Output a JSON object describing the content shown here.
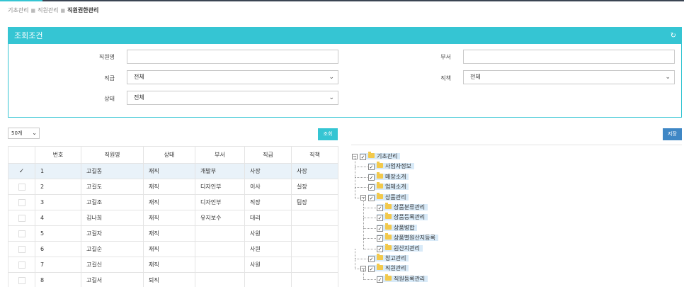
{
  "breadcrumb": {
    "items": [
      "기초관리",
      "직원관리"
    ],
    "current": "직원권한관리"
  },
  "panel": {
    "title": "조회조건",
    "fields": {
      "name_label": "직원명",
      "name_value": "",
      "dept_label": "부서",
      "dept_value": "",
      "grade_label": "직급",
      "grade_value": "전체",
      "position_label": "직책",
      "position_value": "전체",
      "status_label": "상태",
      "status_value": "전체"
    }
  },
  "toolbar": {
    "page_size": "50개",
    "search_label": "조회",
    "save_label": "저장"
  },
  "table": {
    "headers": [
      "",
      "번호",
      "직원명",
      "상태",
      "부서",
      "직급",
      "직책"
    ],
    "rows": [
      {
        "checked": "✓",
        "no": "1",
        "name": "고길동",
        "status": "재직",
        "dept": "개발부",
        "grade": "사장",
        "position": "사장"
      },
      {
        "checked": "",
        "no": "2",
        "name": "고길도",
        "status": "재직",
        "dept": "디자인부",
        "grade": "이사",
        "position": "실장"
      },
      {
        "checked": "",
        "no": "3",
        "name": "고길조",
        "status": "재직",
        "dept": "디자인부",
        "grade": "직장",
        "position": "팀장"
      },
      {
        "checked": "",
        "no": "4",
        "name": "김나희",
        "status": "재직",
        "dept": "유지보수",
        "grade": "대리",
        "position": ""
      },
      {
        "checked": "",
        "no": "5",
        "name": "고길자",
        "status": "재직",
        "dept": "",
        "grade": "사원",
        "position": ""
      },
      {
        "checked": "",
        "no": "6",
        "name": "고길순",
        "status": "재직",
        "dept": "",
        "grade": "사원",
        "position": ""
      },
      {
        "checked": "",
        "no": "7",
        "name": "고길신",
        "status": "재직",
        "dept": "",
        "grade": "사원",
        "position": ""
      },
      {
        "checked": "",
        "no": "8",
        "name": "고길서",
        "status": "퇴직",
        "dept": "",
        "grade": "",
        "position": ""
      }
    ]
  },
  "tree": {
    "nodes": [
      {
        "label": "기초관리",
        "level": 0,
        "toggle": "−",
        "check": "✓"
      },
      {
        "label": "사업자정보",
        "level": 1,
        "toggle": "",
        "check": "✓"
      },
      {
        "label": "매장소개",
        "level": 1,
        "toggle": "",
        "check": "✓"
      },
      {
        "label": "업체소개",
        "level": 1,
        "toggle": "",
        "check": "✓"
      },
      {
        "label": "상품관리",
        "level": 1,
        "toggle": "−",
        "check": "✓"
      },
      {
        "label": "상품분류관리",
        "level": 2,
        "toggle": "",
        "check": "✓"
      },
      {
        "label": "상품등록관리",
        "level": 2,
        "toggle": "",
        "check": "✓"
      },
      {
        "label": "상품병합",
        "level": 2,
        "toggle": "",
        "check": "✓"
      },
      {
        "label": "상품별원산지등록",
        "level": 2,
        "toggle": "",
        "check": "✓"
      },
      {
        "label": "원산지관리",
        "level": 2,
        "toggle": "",
        "check": "✓"
      },
      {
        "label": "창고관리",
        "level": 1,
        "toggle": "",
        "check": "✓"
      },
      {
        "label": "직원관리",
        "level": 1,
        "toggle": "−",
        "check": "✓"
      },
      {
        "label": "직원등록관리",
        "level": 2,
        "toggle": "",
        "check": "✓"
      }
    ]
  },
  "colors": {
    "accent": "#35c5d3",
    "save": "#3f87c5",
    "folder": "#f2c94c",
    "highlight": "#d8eaf8"
  }
}
